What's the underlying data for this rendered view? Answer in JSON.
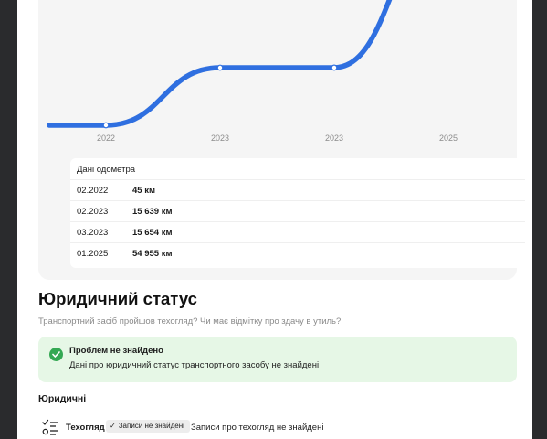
{
  "colors": {
    "line": "#2f6fe0",
    "success": "#34a853",
    "alert_bg": "#e6f7e6",
    "card_bg": "#f5f5f5"
  },
  "chart_data": {
    "type": "line",
    "x_tick_labels": [
      "2022",
      "2023",
      "2023",
      "2025"
    ],
    "points": [
      {
        "date": "02.2022",
        "value": 45
      },
      {
        "date": "02.2023",
        "value": 15639
      },
      {
        "date": "03.2023",
        "value": 15654
      },
      {
        "date": "01.2025",
        "value": 54955
      }
    ],
    "grid": false
  },
  "odometer": {
    "title": "Дані одометра",
    "rows": [
      {
        "date": "02.2022",
        "value": "45 км"
      },
      {
        "date": "02.2023",
        "value": "15 639 км"
      },
      {
        "date": "03.2023",
        "value": "15 654 км"
      },
      {
        "date": "01.2025",
        "value": "54 955 км"
      }
    ]
  },
  "legal": {
    "title": "Юридичний статус",
    "subtitle": "Транспортний засіб пройшов техогляд? Чи має відмітку про здачу в утиль?",
    "alert_title": "Проблем не знайдено",
    "alert_text": "Дані про юридичний статус транспортного засобу не знайдені",
    "section_title": "Юридичні",
    "tech": {
      "name": "Техогляд",
      "chip": "Записи не знайдені",
      "desc": "Записи про техогляд не знайдені"
    }
  }
}
